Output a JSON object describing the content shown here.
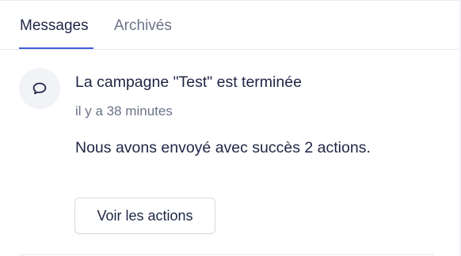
{
  "tabs": [
    {
      "label": "Messages",
      "active": true
    },
    {
      "label": "Archivés",
      "active": false
    }
  ],
  "notification": {
    "icon": "chat-bubble-icon",
    "title": "La campagne \"Test\" est terminée",
    "time": "il y a 38 minutes",
    "body": "Nous avons envoyé avec succès 2 actions.",
    "action_label": "Voir les actions"
  },
  "colors": {
    "accent": "#3f5bd6",
    "text_primary": "#1f2544",
    "text_muted": "#6b7388",
    "icon_background": "#f2f3f7"
  }
}
